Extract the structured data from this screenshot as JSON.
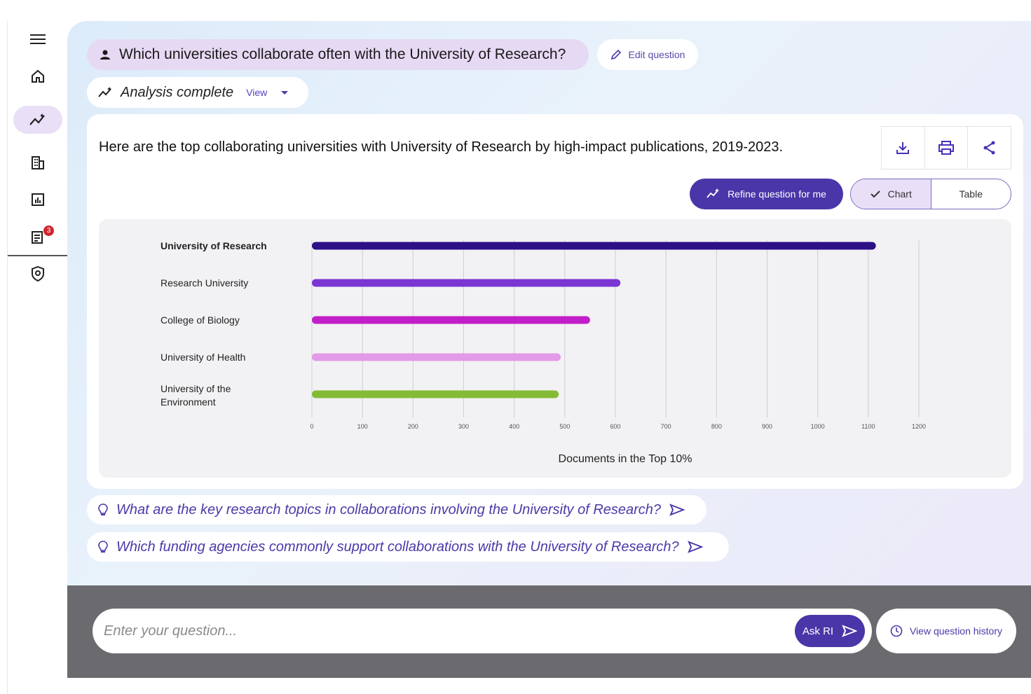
{
  "nav": {
    "items": [
      {
        "name": "menu-icon"
      },
      {
        "name": "home-icon"
      },
      {
        "name": "analytics-icon",
        "active": true
      },
      {
        "name": "building-icon"
      },
      {
        "name": "report-icon"
      },
      {
        "name": "notes-icon",
        "badge": "3"
      },
      {
        "name": "shield-icon"
      }
    ]
  },
  "question": {
    "text": "Which universities collaborate often with the University of Research?",
    "edit_label": "Edit question"
  },
  "analysis": {
    "status": "Analysis complete",
    "view_label": "View"
  },
  "result": {
    "title": "Here are the top collaborating universities with University of Research by high-impact publications, 2019-2023.",
    "refine_label": "Refine question for me",
    "chart_label": "Chart",
    "table_label": "Table"
  },
  "chart_data": {
    "type": "bar",
    "orientation": "horizontal",
    "categories": [
      [
        "University of Research"
      ],
      [
        "Research University"
      ],
      [
        "College of Biology"
      ],
      [
        "University of Health"
      ],
      [
        "University of the",
        "Environment"
      ]
    ],
    "values": [
      1115,
      610,
      550,
      492,
      488
    ],
    "colors": [
      "#2d0f86",
      "#7a35d2",
      "#c21ec9",
      "#e39ae8",
      "#84bb35"
    ],
    "xlabel": "Documents in the Top 10%",
    "ylabel": "",
    "xlim": [
      0,
      1200
    ],
    "xticks": [
      0,
      100,
      200,
      300,
      400,
      500,
      600,
      700,
      800,
      900,
      1000,
      1100,
      1200
    ],
    "grid": true
  },
  "suggestions": [
    "What are the key research topics in collaborations involving the University of Research?",
    "Which funding agencies commonly support collaborations with the University of Research?"
  ],
  "input": {
    "placeholder": "Enter your question...",
    "ask_label": "Ask RI",
    "history_label": "View question history"
  },
  "colors": {
    "accent": "#4a36a8",
    "pill": "#e6d9f3"
  }
}
